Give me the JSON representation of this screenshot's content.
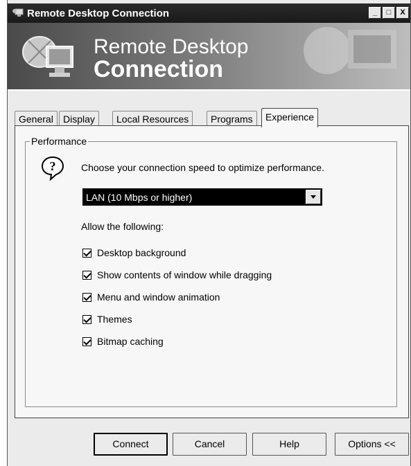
{
  "window": {
    "title": "Remote Desktop Connection",
    "icon": "remote-desktop-icon",
    "controls": {
      "minimize": "_",
      "maximize": "□",
      "close": "X"
    }
  },
  "banner": {
    "line1": "Remote Desktop",
    "line2": "Connection"
  },
  "tabs": [
    {
      "label": "General"
    },
    {
      "label": "Display"
    },
    {
      "label": "Local Resources"
    },
    {
      "label": "Programs"
    },
    {
      "label": "Experience",
      "active": true
    }
  ],
  "performance": {
    "group_label": "Performance",
    "prompt": "Choose your connection speed to optimize performance.",
    "speed_select": {
      "value": "LAN (10 Mbps or higher)"
    },
    "allow_label": "Allow the following:",
    "options": [
      {
        "label": "Desktop background",
        "checked": true
      },
      {
        "label": "Show contents of window while dragging",
        "checked": true
      },
      {
        "label": "Menu and window animation",
        "checked": true
      },
      {
        "label": "Themes",
        "checked": true
      },
      {
        "label": "Bitmap caching",
        "checked": true
      }
    ]
  },
  "buttons": {
    "connect": "Connect",
    "cancel": "Cancel",
    "help": "Help",
    "options": "Options <<"
  }
}
